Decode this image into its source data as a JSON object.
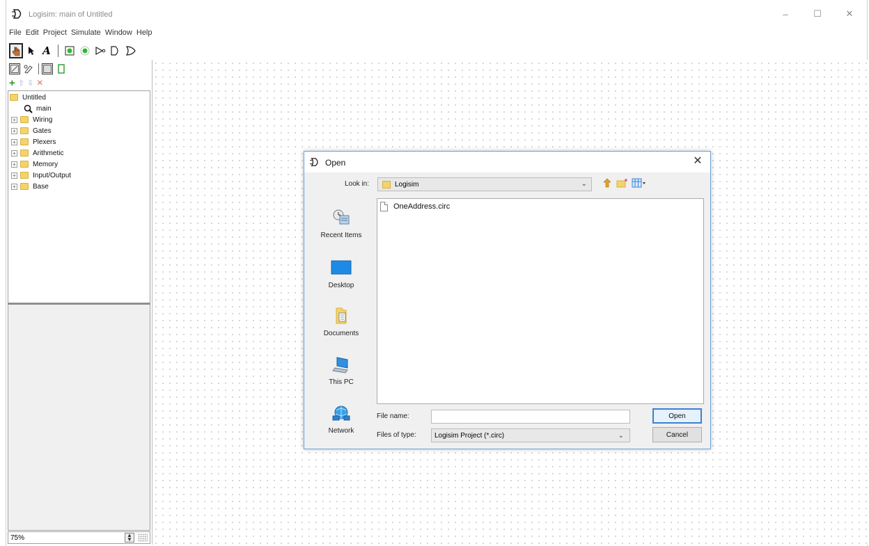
{
  "window": {
    "title": "Logisim: main of Untitled",
    "controls": [
      "minimize",
      "maximize",
      "close"
    ]
  },
  "menu": [
    "File",
    "Edit",
    "Project",
    "Simulate",
    "Window",
    "Help"
  ],
  "toolbar": {
    "text_tool_glyph": "A"
  },
  "explorer": {
    "project": "Untitled",
    "circuit": "main",
    "libraries": [
      "Wiring",
      "Gates",
      "Plexers",
      "Arithmetic",
      "Memory",
      "Input/Output",
      "Base"
    ]
  },
  "zoom": {
    "value": "75%"
  },
  "dialog": {
    "title": "Open",
    "look_in_label": "Look in:",
    "look_in_value": "Logisim",
    "places": [
      "Recent Items",
      "Desktop",
      "Documents",
      "This PC",
      "Network"
    ],
    "files": [
      "OneAddress.circ"
    ],
    "file_name_label": "File name:",
    "file_name_value": "",
    "files_of_type_label": "Files of type:",
    "files_of_type_value": "Logisim Project (*.circ)",
    "open_button": "Open",
    "cancel_button": "Cancel"
  },
  "colors": {
    "accent": "#3c7fd6",
    "folder": "#f4d36c",
    "add_green": "#2a9a2a",
    "remove_red": "#d04040"
  }
}
